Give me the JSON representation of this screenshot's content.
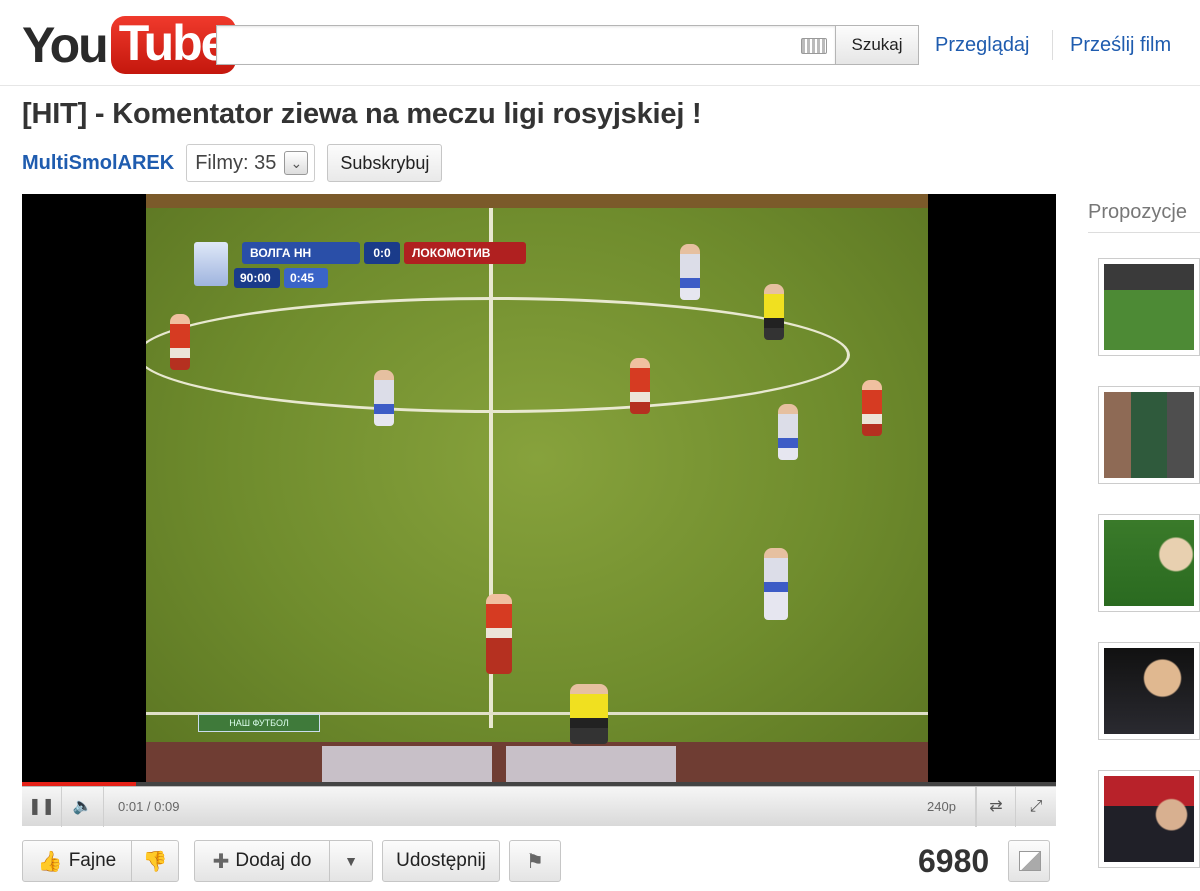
{
  "header": {
    "logo_you": "You",
    "logo_tube": "Tube",
    "search_value": "",
    "search_button": "Szukaj",
    "nav_browse": "Przeglądaj",
    "nav_upload": "Prześlij film"
  },
  "video": {
    "title": "[HIT] - Komentator ziewa na meczu ligi rosyjskiej !",
    "channel": "MultiSmolAREK",
    "films_label": "Filmy: 35",
    "subscribe": "Subskrybuj",
    "scoreboard": {
      "home": "ВОЛГА НН",
      "score": "0:0",
      "away": "ЛОКОМОТИВ",
      "clock": "90:00",
      "added": "0:45"
    },
    "channel_tag": "НАШ ФУТБОЛ"
  },
  "player": {
    "time": "0:01 / 0:09",
    "quality": "240p",
    "progress_fraction": 0.11
  },
  "actions": {
    "like": "Fajne",
    "add_to": "Dodaj do",
    "share": "Udostępnij",
    "views": "6980"
  },
  "sidebar": {
    "title": "Propozycje"
  },
  "colors": {
    "accent_red": "#e62117",
    "link_blue": "#1f5caf"
  }
}
